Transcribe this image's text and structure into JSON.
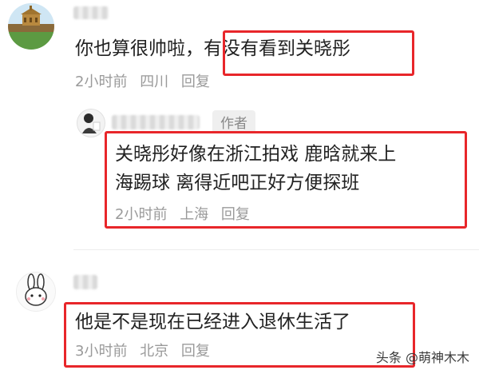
{
  "comments": [
    {
      "text": "你也算很帅啦，",
      "highlight": "有没有看到关晓彤",
      "time": "2小时前",
      "location": "四川",
      "reply_label": "回复"
    },
    {
      "badge": "作者",
      "line1": "关晓彤好像在浙江拍戏 鹿晗就来上",
      "line2": "海踢球 离得近吧正好方便探班",
      "time": "2小时前",
      "location": "上海",
      "reply_label": "回复"
    },
    {
      "text": "他是不是现在已经进入退休生活了",
      "time": "3小时前",
      "location": "北京",
      "reply_label": "回复"
    }
  ],
  "watermark": "头条 @萌神木木",
  "colors": {
    "highlight_border": "#e8262a",
    "meta_text": "#9a9a9a",
    "main_text": "#222222"
  },
  "icons": {
    "avatar_1": "landscape-avatar-icon",
    "avatar_2": "person-avatar-icon",
    "avatar_3": "bunny-avatar-icon"
  }
}
